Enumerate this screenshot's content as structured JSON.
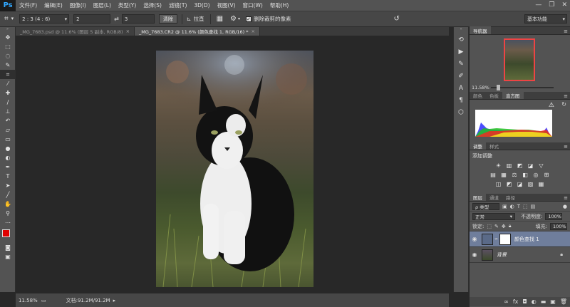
{
  "app": {
    "logo": "Ps"
  },
  "menu": [
    "文件(F)",
    "编辑(E)",
    "图像(I)",
    "图层(L)",
    "类型(Y)",
    "选择(S)",
    "滤镜(T)",
    "3D(D)",
    "视图(V)",
    "窗口(W)",
    "帮助(H)"
  ],
  "window_controls": {
    "minimize": "—",
    "restore": "❐",
    "close": "✕"
  },
  "options": {
    "ratio_value": "2 : 3 (4 : 6)",
    "width_value": "2",
    "height_value": "3",
    "clear_label": "清除",
    "straighten_label": "拉直",
    "delete_cropped_label": "删除裁剪的像素",
    "delete_cropped_checked": true,
    "workspace": "基本功能"
  },
  "tabs": [
    {
      "label": "_MG_7683.psd @ 11.6% (图层 5 副本, RGB/8)",
      "active": false
    },
    {
      "label": "_MG_7683.CR2 @ 11.6% (颜色查找 1, RGB/16) *",
      "active": true
    }
  ],
  "status": {
    "zoom": "11.58%",
    "doc": "文档:91.2M/91.2M"
  },
  "navigator": {
    "tab": "导航器",
    "zoom": "11.58%"
  },
  "histogram": {
    "tabs": [
      "颜色",
      "色板",
      "直方图"
    ],
    "active": "直方图"
  },
  "adjustments": {
    "tabs": [
      "调整",
      "样式"
    ],
    "title": "添加调整"
  },
  "layers": {
    "tabs": [
      "图层",
      "通道",
      "路径"
    ],
    "filter_label": "ρ 类型",
    "blend_mode": "正常",
    "opacity_label": "不透明度:",
    "opacity": "100%",
    "lock_label": "锁定:",
    "fill_label": "填充:",
    "fill": "100%",
    "items": [
      {
        "name": "颜色查找 1",
        "selected": true,
        "italic": false
      },
      {
        "name": "背景",
        "selected": false,
        "italic": true
      }
    ]
  },
  "colors": {
    "foreground": "#e00000",
    "background": "#000000",
    "selected_layer": "#6f7e9c",
    "accent": "#31a8ff"
  }
}
